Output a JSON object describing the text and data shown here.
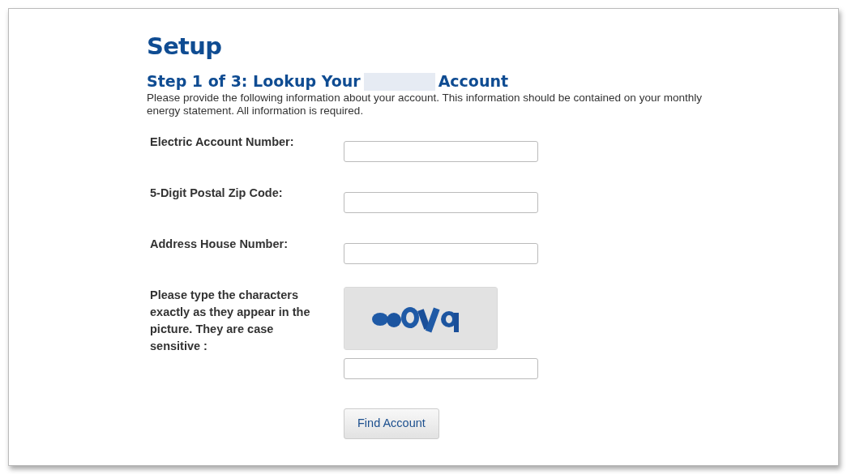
{
  "title": "Setup",
  "step_heading": {
    "before": "Step 1 of 3: Lookup Your",
    "after": "Account",
    "redacted": true
  },
  "intro": "Please provide the following information about your account. This information should be contained on your monthly energy statement. All information is required.",
  "fields": [
    {
      "kind": "text",
      "label": "Electric Account Number:"
    },
    {
      "kind": "text",
      "label": "5-Digit Postal Zip Code:"
    },
    {
      "kind": "text",
      "label": "Address House Number:"
    },
    {
      "kind": "captcha",
      "label": "Please type the characters exactly as they appear in the picture. They are case sensitive :"
    }
  ],
  "submit": "Find Account"
}
